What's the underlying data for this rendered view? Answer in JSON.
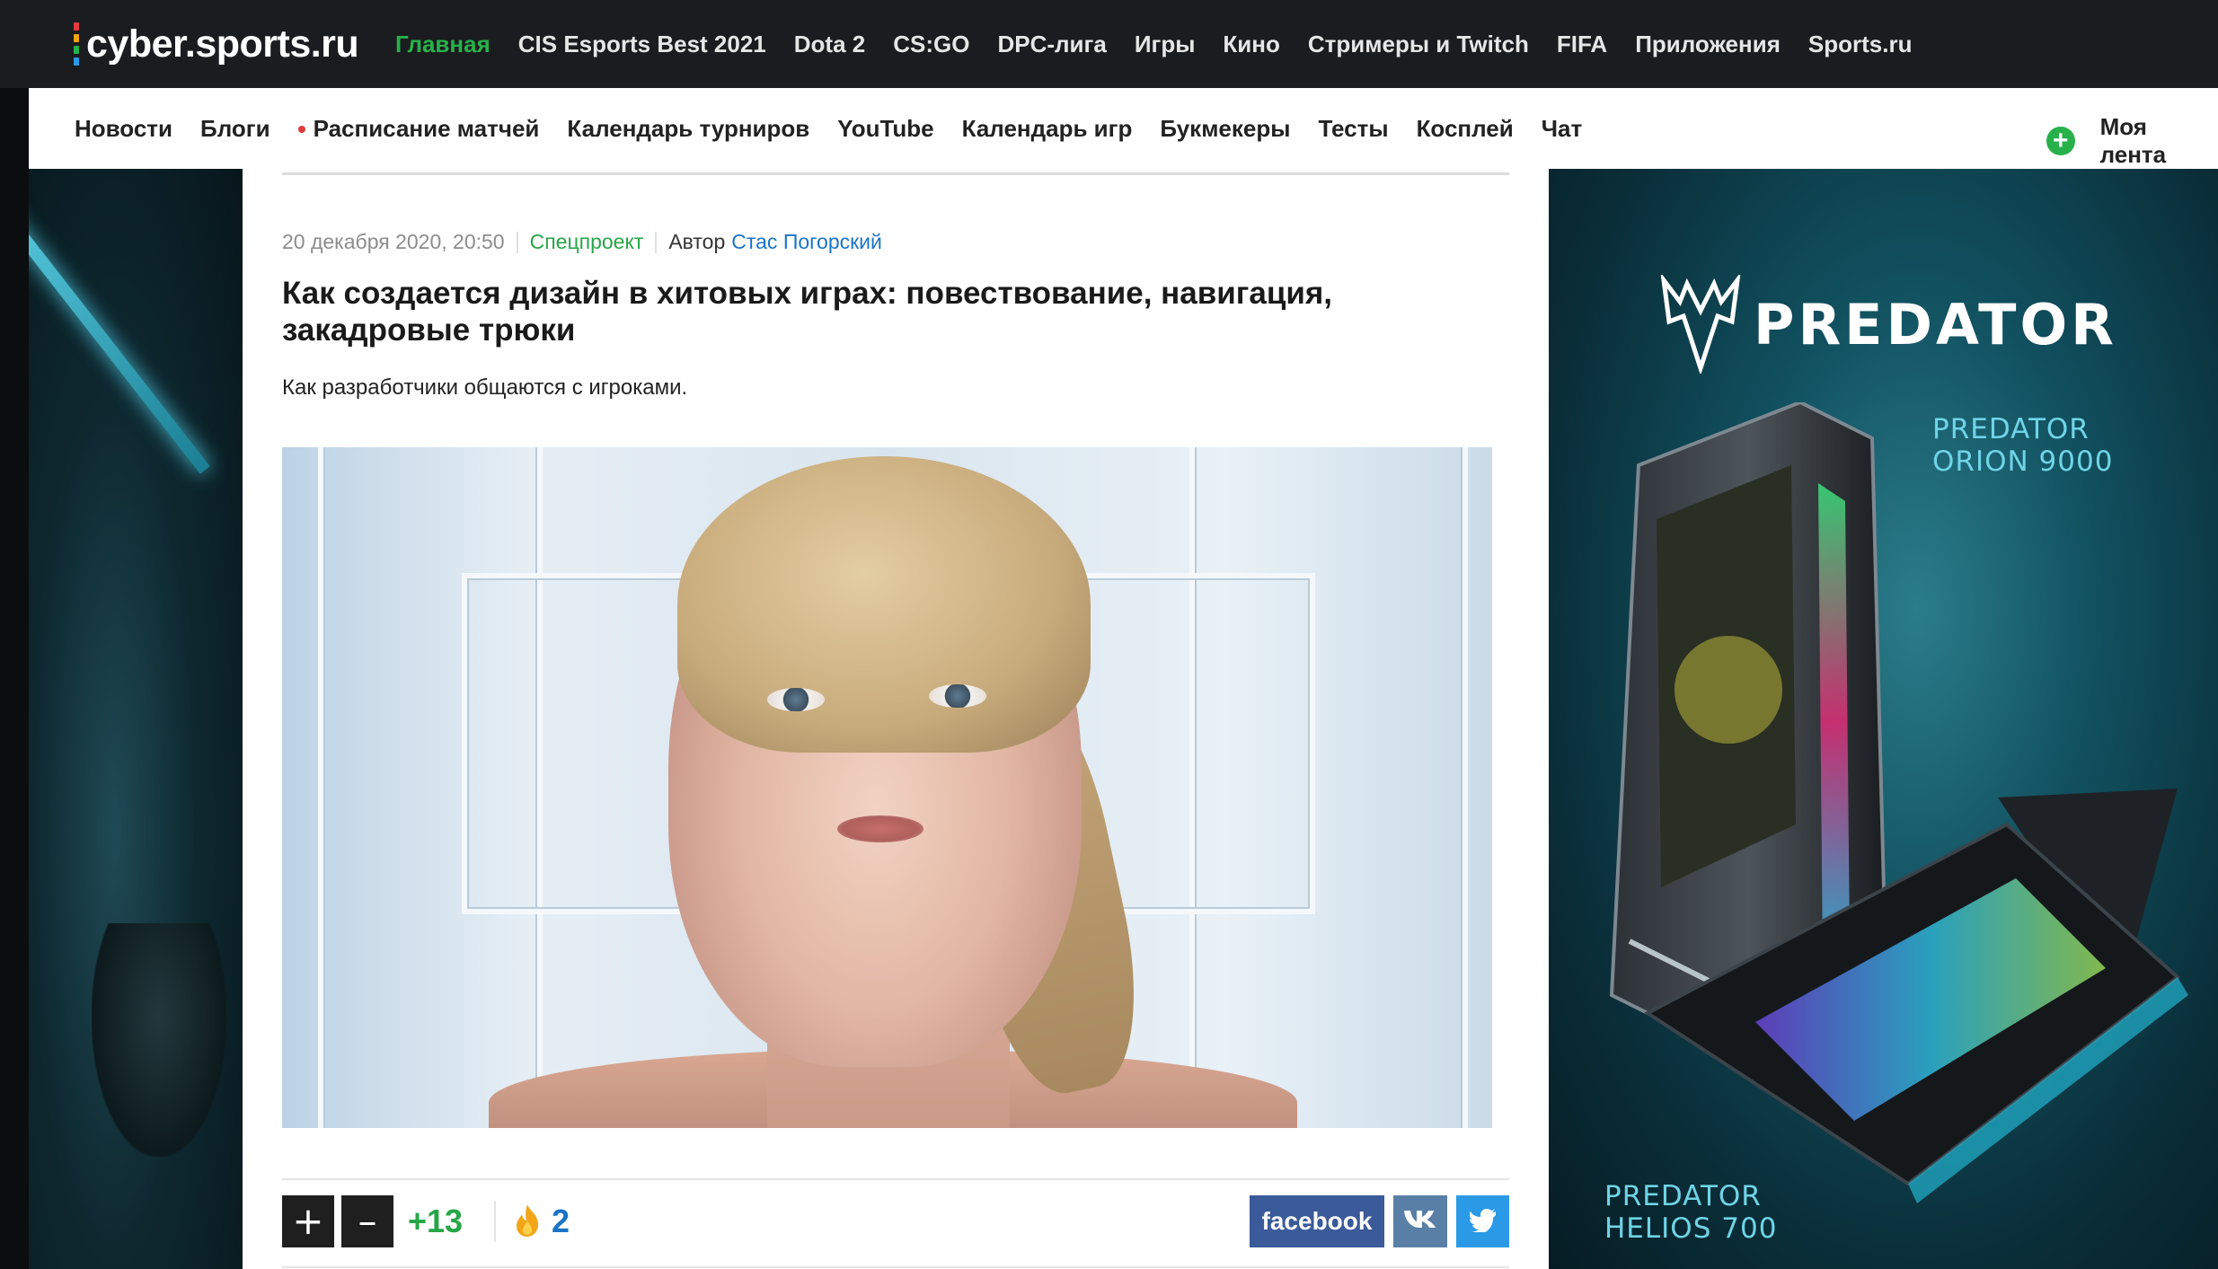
{
  "site": {
    "logo": "cyber.sports.ru",
    "logo_dot_colors": [
      "#e23b3b",
      "#f1a20f",
      "#27b14a",
      "#2b9ae6"
    ]
  },
  "top_nav": [
    {
      "label": "Главная",
      "active": true
    },
    {
      "label": "CIS Esports Best 2021"
    },
    {
      "label": "Dota 2"
    },
    {
      "label": "CS:GO"
    },
    {
      "label": "DPC-лига"
    },
    {
      "label": "Игры"
    },
    {
      "label": "Кино"
    },
    {
      "label": "Стримеры и Twitch"
    },
    {
      "label": "FIFA"
    },
    {
      "label": "Приложения"
    },
    {
      "label": "Sports.ru"
    }
  ],
  "sub_nav": [
    {
      "label": "Новости"
    },
    {
      "label": "Блоги"
    },
    {
      "label": "Расписание матчей",
      "dot": true
    },
    {
      "label": "Календарь турниров"
    },
    {
      "label": "YouTube"
    },
    {
      "label": "Календарь игр"
    },
    {
      "label": "Букмекеры"
    },
    {
      "label": "Тесты"
    },
    {
      "label": "Косплей"
    },
    {
      "label": "Чат"
    }
  ],
  "my_feed": {
    "label": "Моя лента",
    "icon": "plus-circle-icon"
  },
  "article": {
    "date": "20 декабря 2020, 20:50",
    "category": "Спецпроект",
    "author_label": "Автор",
    "author": "Стас Погорский",
    "title": "Как создается дизайн в хитовых играх: повествование, навигация, закадровые трюки",
    "lead": "Как разработчики общаются с игроками."
  },
  "actions": {
    "plus": "+",
    "minus": "–",
    "score": "+13",
    "hot_count": "2",
    "share": {
      "facebook": "facebook",
      "vk": "vk"
    }
  },
  "ad": {
    "brand": "PREDATOR",
    "product1_line1": "PREDATOR",
    "product1_line2": "ORION 9000",
    "product2_line1": "PREDATOR",
    "product2_line2": "HELIOS 700"
  },
  "colors": {
    "accent_green": "#27b14a",
    "link_blue": "#1a74c6",
    "facebook": "#3b5a9a",
    "vk": "#5a7fa6",
    "twitter": "#2b9ae6"
  }
}
